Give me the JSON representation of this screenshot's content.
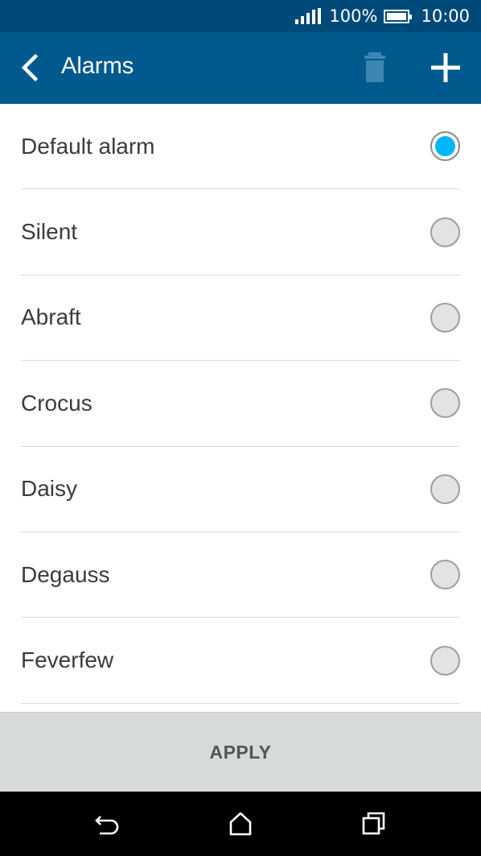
{
  "status_bar": {
    "battery_percent": "100%",
    "time": "10:00"
  },
  "app_bar": {
    "title": "Alarms",
    "icons": [
      "back-arrow-icon",
      "trash-icon",
      "plus-icon"
    ],
    "trash_enabled": false
  },
  "alarms": {
    "items": [
      {
        "label": "Default alarm",
        "selected": true
      },
      {
        "label": "Silent",
        "selected": false
      },
      {
        "label": "Abraft",
        "selected": false
      },
      {
        "label": "Crocus",
        "selected": false
      },
      {
        "label": "Daisy",
        "selected": false
      },
      {
        "label": "Degauss",
        "selected": false
      },
      {
        "label": "Feverfew",
        "selected": false
      }
    ]
  },
  "apply": {
    "label": "APPLY"
  },
  "nav_bar": {
    "icons": [
      "back-icon",
      "home-icon",
      "recent-apps-icon"
    ]
  },
  "colors": {
    "status_bar": "#004a7a",
    "app_bar": "#005a8e",
    "accent": "#00b4ff",
    "apply_bar": "#d7dadb"
  }
}
